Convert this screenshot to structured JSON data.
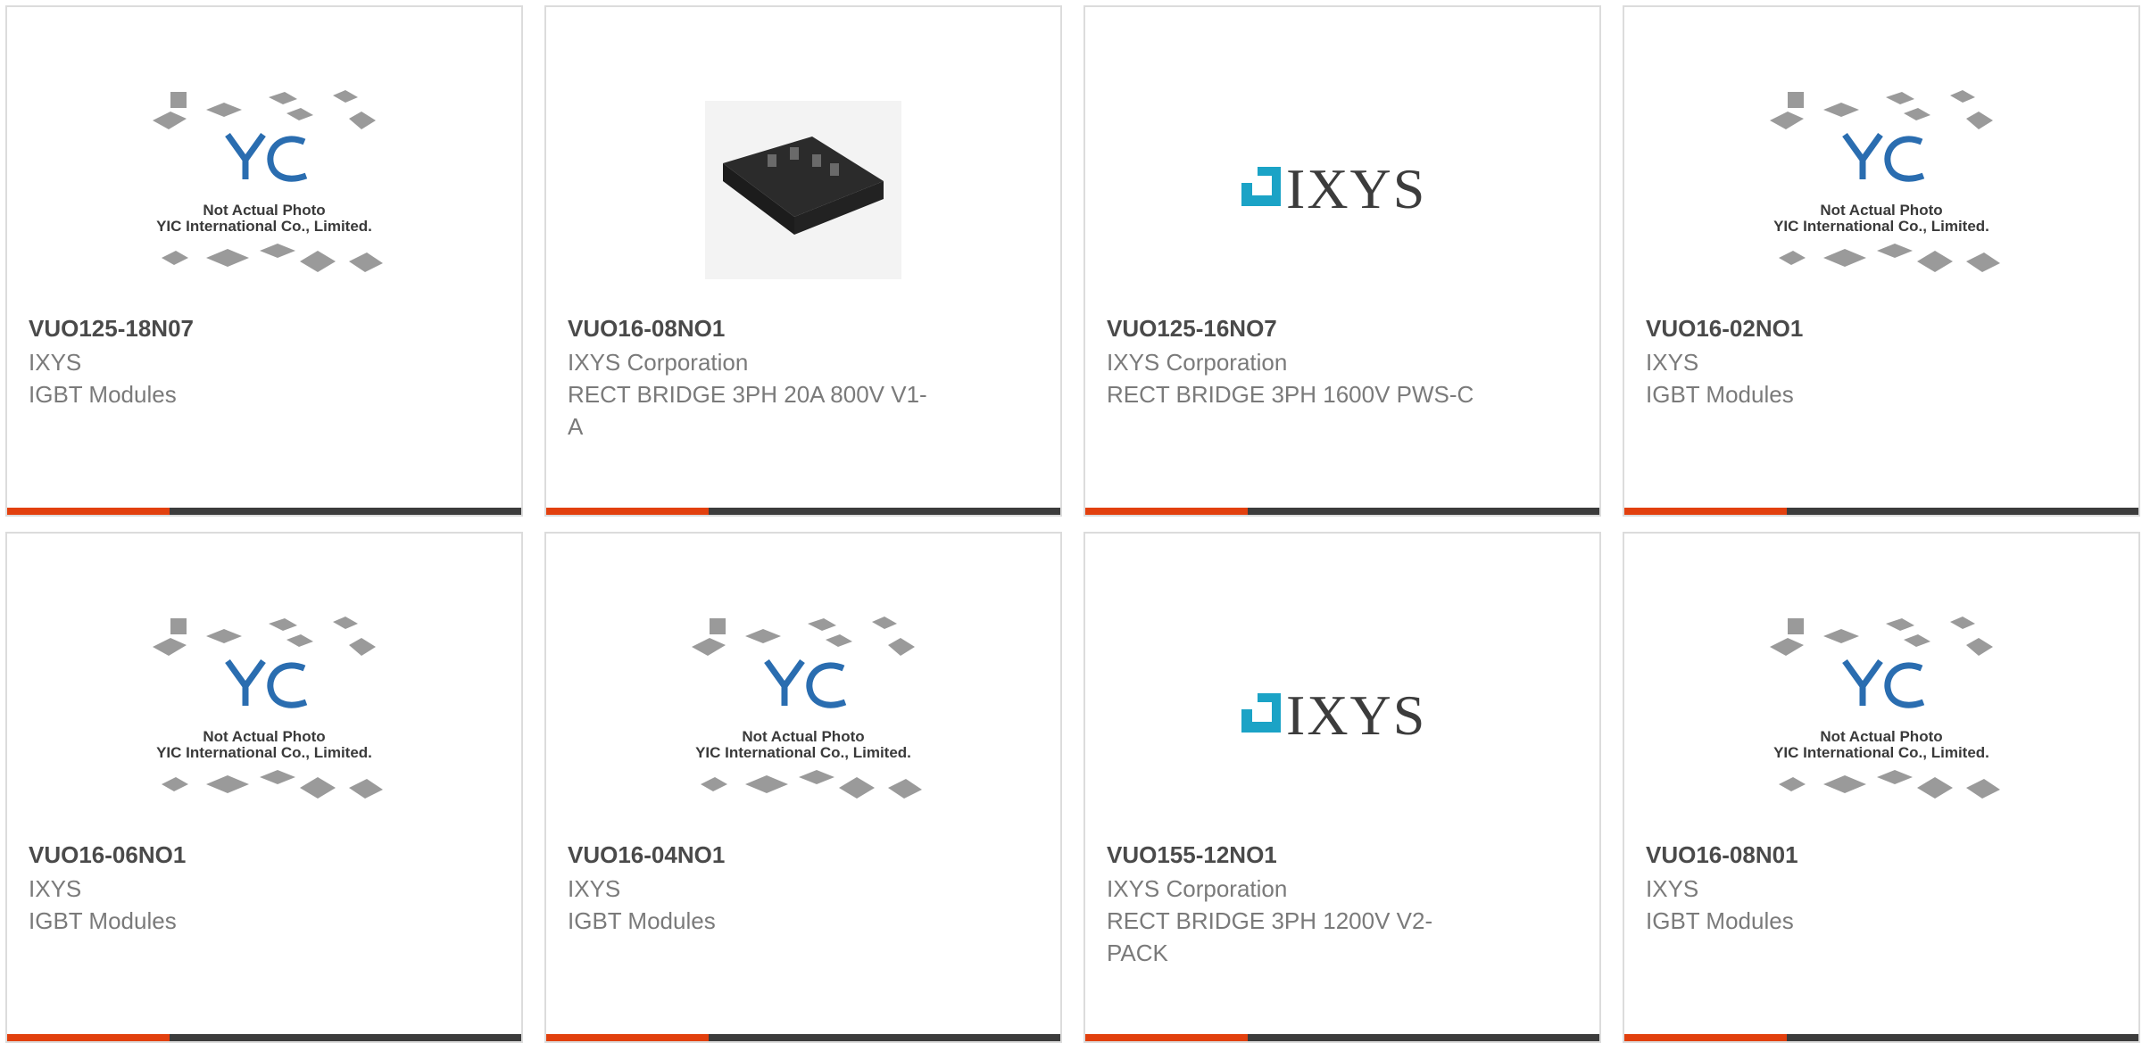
{
  "products": [
    {
      "part_number": "VUO125-18N07",
      "manufacturer": "IXYS",
      "description": "IGBT Modules",
      "image": "placeholder"
    },
    {
      "part_number": "VUO16-08NO1",
      "manufacturer": "IXYS Corporation",
      "description": "RECT BRIDGE 3PH 20A 800V V1-A",
      "image": "module-photo"
    },
    {
      "part_number": "VUO125-16NO7",
      "manufacturer": "IXYS Corporation",
      "description": "RECT BRIDGE 3PH 1600V PWS-C",
      "image": "ixys-logo"
    },
    {
      "part_number": "VUO16-02NO1",
      "manufacturer": "IXYS",
      "description": "IGBT Modules",
      "image": "placeholder"
    },
    {
      "part_number": "VUO16-06NO1",
      "manufacturer": "IXYS",
      "description": "IGBT Modules",
      "image": "placeholder"
    },
    {
      "part_number": "VUO16-04NO1",
      "manufacturer": "IXYS",
      "description": "IGBT Modules",
      "image": "placeholder"
    },
    {
      "part_number": "VUO155-12NO1",
      "manufacturer": "IXYS Corporation",
      "description": "RECT BRIDGE 3PH 1200V V2-PACK",
      "image": "ixys-logo"
    },
    {
      "part_number": "VUO16-08N01",
      "manufacturer": "IXYS",
      "description": "IGBT Modules",
      "image": "placeholder"
    }
  ],
  "placeholder_caption_1": "Not Actual Photo",
  "placeholder_caption_2": "YIC International Co., Limited.",
  "placeholder_logo_text": "YIC",
  "logo_text": "IXYS",
  "colors": {
    "accent": "#e2400e",
    "bar": "#3c3c3c",
    "logo_teal": "#1ba3c6"
  }
}
